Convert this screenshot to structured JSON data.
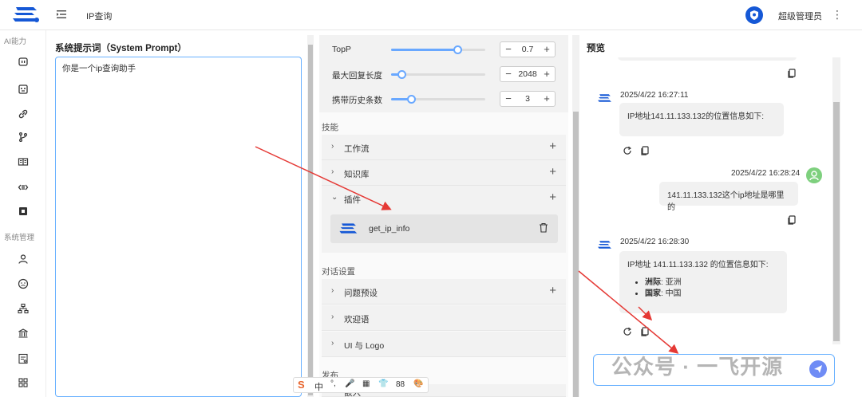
{
  "header": {
    "page_tab": "IP查询",
    "user_name": "超级管理员",
    "more_icon": "more-vertical-icon"
  },
  "sidebar": {
    "group_ai": "AI能力",
    "group_system": "系统管理",
    "ai_icons": [
      "chat-icon",
      "robot-icon",
      "link-icon",
      "branch-icon",
      "book-icon",
      "code-icon",
      "chip-icon"
    ],
    "system_icons": [
      "user-icon",
      "role-icon",
      "org-icon",
      "bank-icon",
      "log-icon",
      "grid-icon"
    ]
  },
  "prompt": {
    "title": "系统提示词（System Prompt）",
    "value": "你是一个ip查询助手"
  },
  "params": [
    {
      "label": "TopP",
      "value": "0.7",
      "fill": 0.7
    },
    {
      "label": "最大回复长度",
      "value": "2048",
      "fill": 0.1
    },
    {
      "label": "携带历史条数",
      "value": "3",
      "fill": 0.2
    }
  ],
  "skills": {
    "label": "技能",
    "items": [
      {
        "label": "工作流",
        "chevron": "›"
      },
      {
        "label": "知识库",
        "chevron": "›"
      },
      {
        "label": "插件",
        "chevron": "⌄"
      }
    ],
    "plugin_name": "get_ip_info"
  },
  "dialog": {
    "label": "对话设置",
    "items": [
      {
        "label": "问题预设",
        "add": true
      },
      {
        "label": "欢迎语",
        "add": false
      },
      {
        "label": "UI 与 Logo",
        "add": false
      }
    ]
  },
  "publish": {
    "label": "发布",
    "item": "嵌入"
  },
  "preview": {
    "title": "预览",
    "msg1_time": "2025/4/22 16:27:11",
    "msg1_text": "IP地址141.11.133.132的位置信息如下:",
    "msg2_time": "2025/4/22 16:28:24",
    "msg2_text": "141.11.133.132这个ip地址是哪里的",
    "msg3_time": "2025/4/22 16:28:30",
    "msg3_text": "IP地址 141.11.133.132 的位置信息如下:",
    "msg3_bullets": [
      {
        "key": "洲际",
        "val": "亚洲"
      },
      {
        "key": "国家",
        "val": "中国"
      }
    ]
  },
  "ime": {
    "items": [
      "中",
      "°,",
      "🎤",
      "▦",
      "👕",
      "88",
      "🎨"
    ]
  },
  "watermark": "公众号 · 一飞开源",
  "colors": {
    "accent": "#1558d6",
    "input_border": "#69b1ff",
    "arrow": "#e53935"
  }
}
